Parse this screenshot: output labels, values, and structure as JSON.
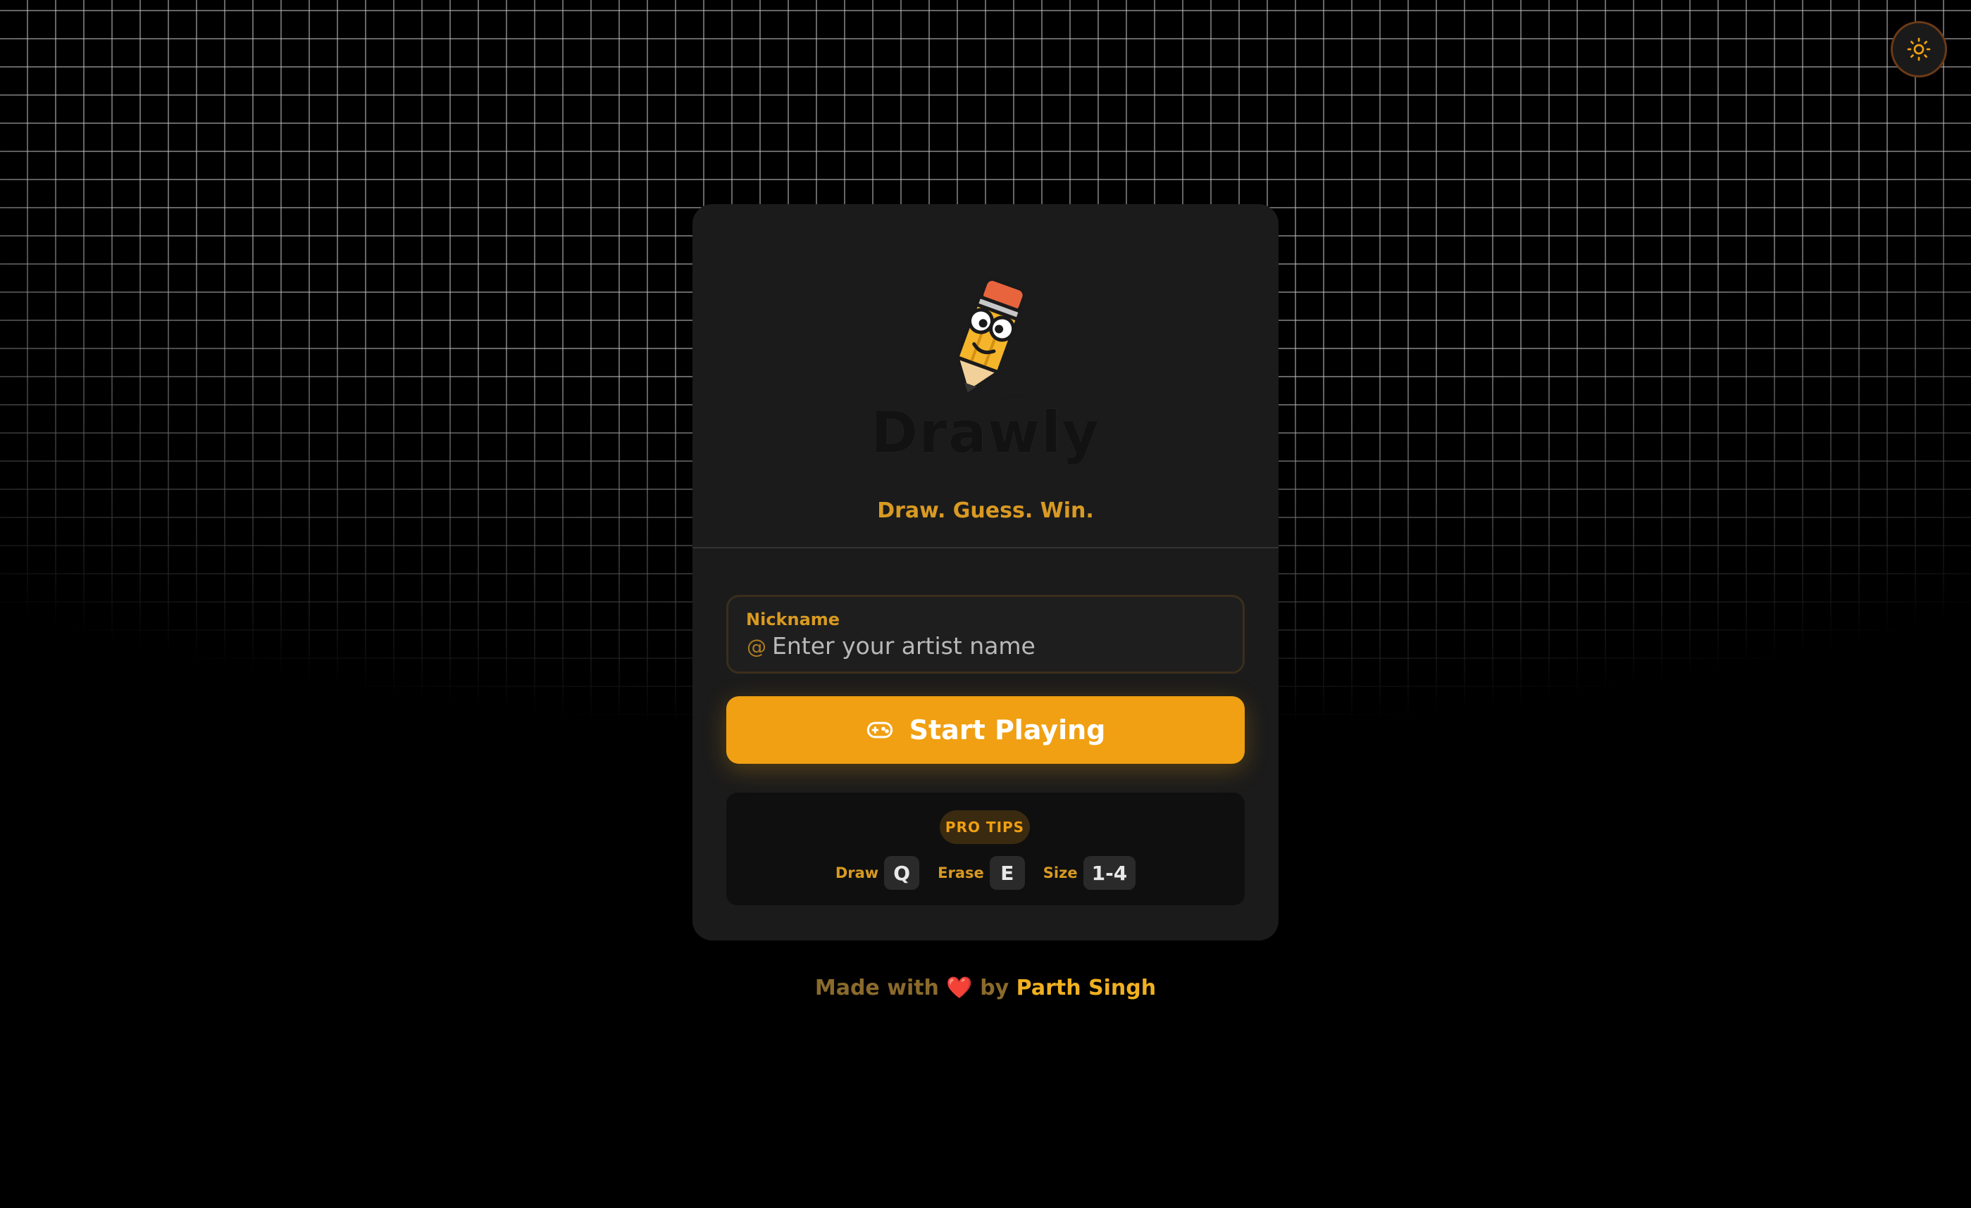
{
  "app": {
    "logo_text": "Drawly",
    "tagline": "Draw. Guess. Win."
  },
  "header": {
    "theme_toggle_icon": "sun-icon"
  },
  "nickname": {
    "label": "Nickname",
    "prefix": "@",
    "placeholder": "Enter your artist name",
    "value": ""
  },
  "start_button": {
    "label": "Start Playing",
    "icon": "gamepad-icon"
  },
  "pro_tips": {
    "badge": "PRO TIPS",
    "items": [
      {
        "label": "Draw",
        "key": "Q"
      },
      {
        "label": "Erase",
        "key": "E"
      },
      {
        "label": "Size",
        "key": "1-4"
      }
    ]
  },
  "footer": {
    "made_with": "Made with",
    "heart": "❤️",
    "by": "by",
    "author": "Parth Singh"
  },
  "colors": {
    "accent": "#f0a012",
    "background": "#000000",
    "card": "#1b1b1b"
  }
}
